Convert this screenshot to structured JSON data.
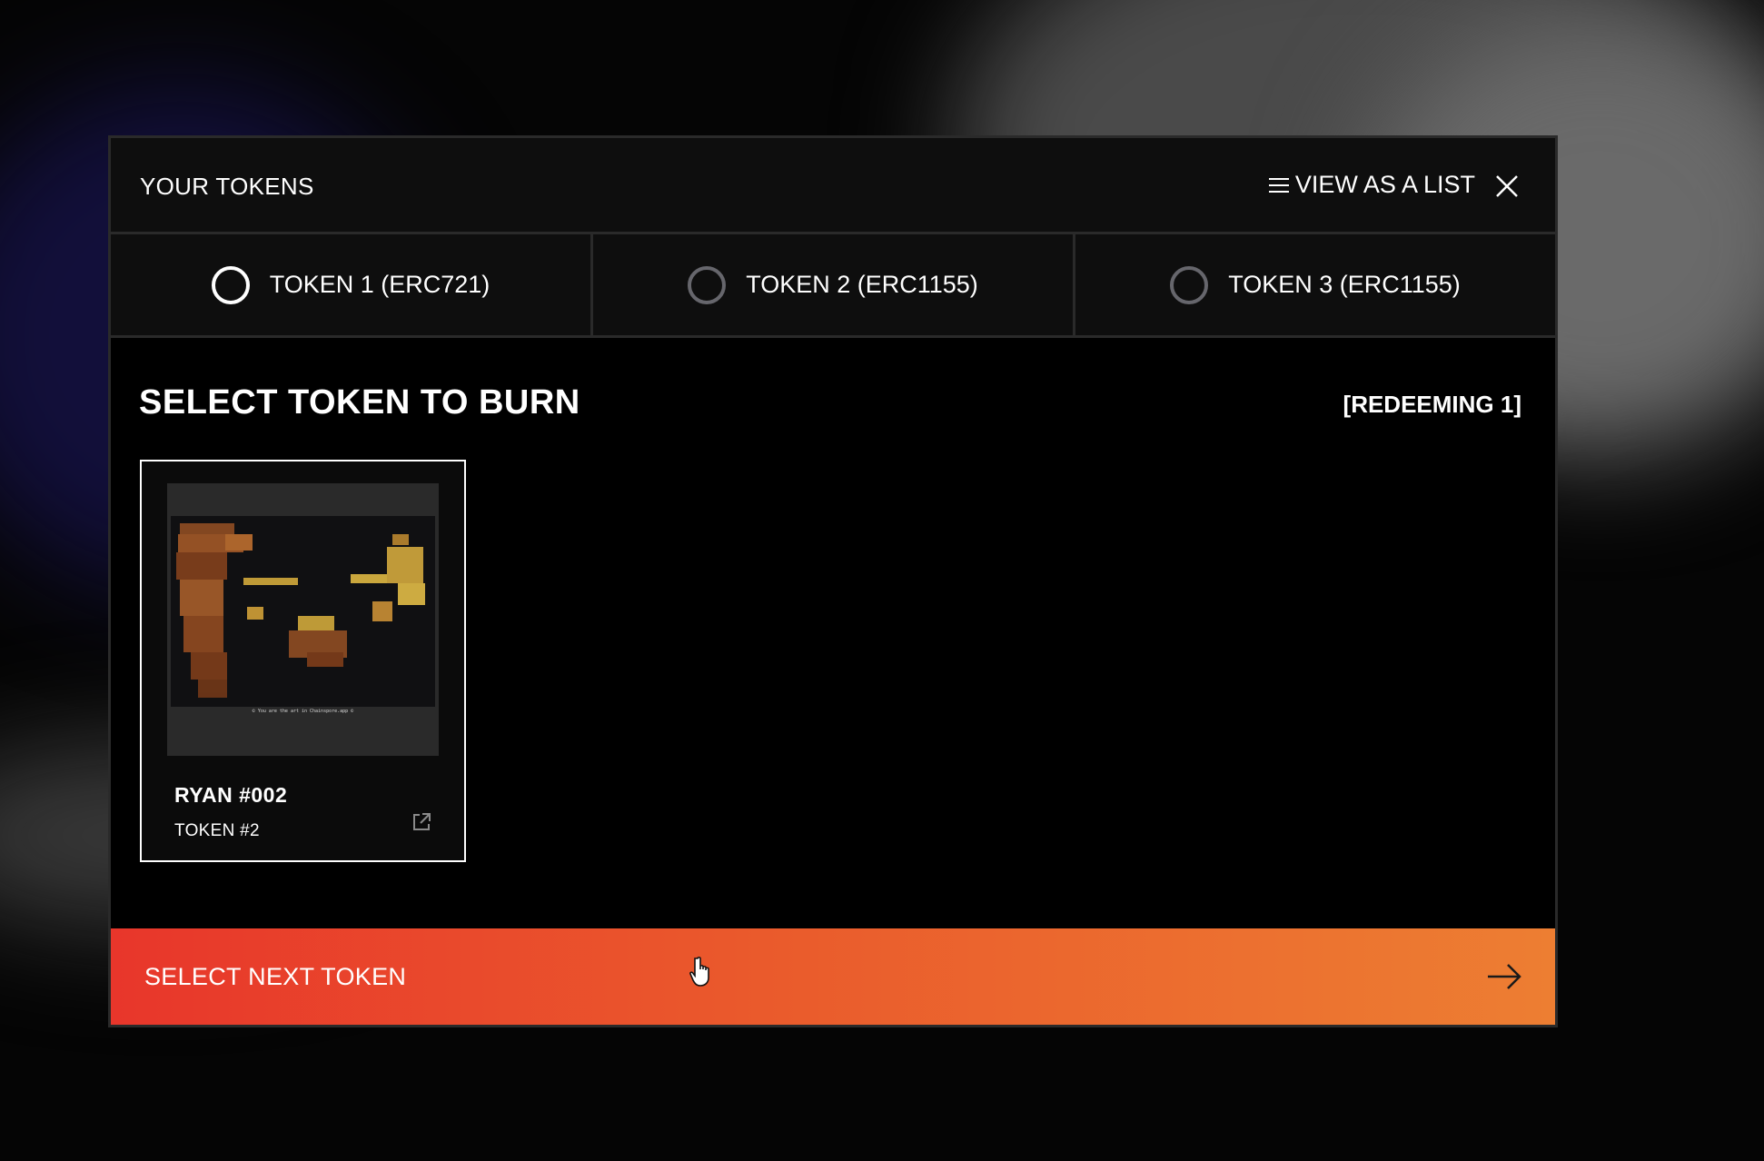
{
  "modal": {
    "title": "YOUR TOKENS",
    "view_list_label": "VIEW AS A LIST",
    "view_list_icon": "list-icon",
    "close_icon": "close-icon"
  },
  "tabs": [
    {
      "label": "TOKEN 1 (ERC721)",
      "selected": true
    },
    {
      "label": "TOKEN 2 (ERC1155)",
      "selected": false
    },
    {
      "label": "TOKEN 3 (ERC1155)",
      "selected": false
    }
  ],
  "section": {
    "title": "SELECT TOKEN TO BURN",
    "redeeming": "[REDEEMING 1]"
  },
  "card": {
    "name": "RYAN #002",
    "subtitle": "TOKEN #2",
    "image_caption": "© You are the art in Chainspore.app ©",
    "external_icon": "external-link-icon"
  },
  "next_button": {
    "label": "SELECT NEXT TOKEN",
    "icon": "arrow-right-icon"
  },
  "colors": {
    "accent_start": "#e8362b",
    "accent_end": "#ed7e32",
    "panel_bg": "#0e0e0e",
    "border": "#2a2a2a"
  }
}
